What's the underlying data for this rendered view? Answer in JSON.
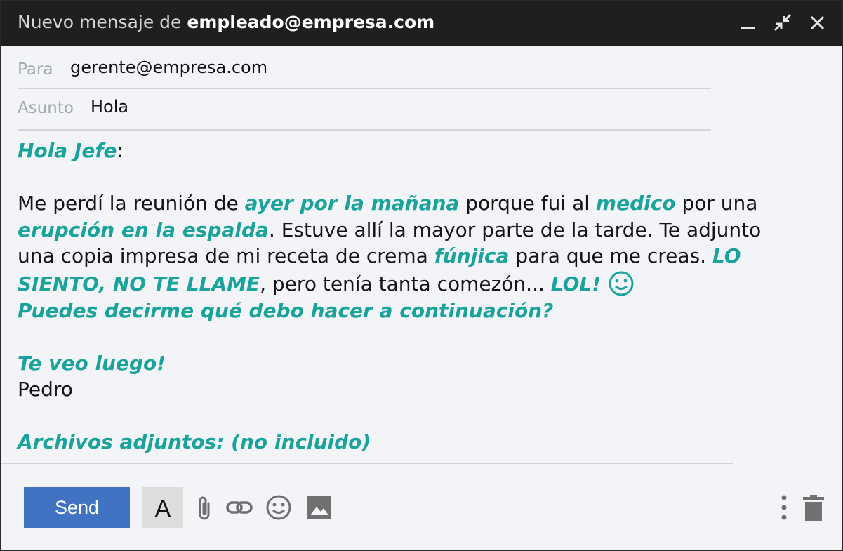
{
  "window": {
    "title_prefix": "Nuevo mensaje de ",
    "title_sender": "empleado@empresa.com"
  },
  "fields": {
    "to_label": "Para",
    "to_value": "gerente@empresa.com",
    "subject_label": "Asunto",
    "subject_value": "Hola"
  },
  "body": {
    "greeting": "Hola Jefe",
    "greeting_punct": ":",
    "p1_a": "Me perdí la reunión de ",
    "p1_b": "ayer por la mañana",
    "p1_c": " porque fui al ",
    "p1_d": "medico",
    "p1_e": " por una ",
    "p1_f": "erupción en la espalda",
    "p1_g": ". Estuve allí la mayor parte de la tarde. Te adjunto una copia impresa de mi receta de crema ",
    "p1_h": "fúnjica",
    "p1_i": " para que me creas. ",
    "p1_j": "LO SIENTO, NO TE LLAME",
    "p1_k": ", pero tenía tanta comezón... ",
    "p1_l": "LOL!",
    "p1_m": "Puedes decirme qué debo hacer a continuación?",
    "closing": "Te veo luego!",
    "signature": "Pedro",
    "attachments": "Archivos adjuntos: (no incluido)"
  },
  "toolbar": {
    "send_label": "Send",
    "format_label": "A"
  },
  "colors": {
    "accent": "#1aa39c",
    "send_button": "#4073c1",
    "titlebar": "#1f1f1f"
  },
  "icons": [
    "minimize-icon",
    "exit-fullscreen-icon",
    "close-icon",
    "smiley-icon",
    "attach-icon",
    "link-icon",
    "emoji-icon",
    "image-icon",
    "more-options-icon",
    "trash-icon"
  ]
}
